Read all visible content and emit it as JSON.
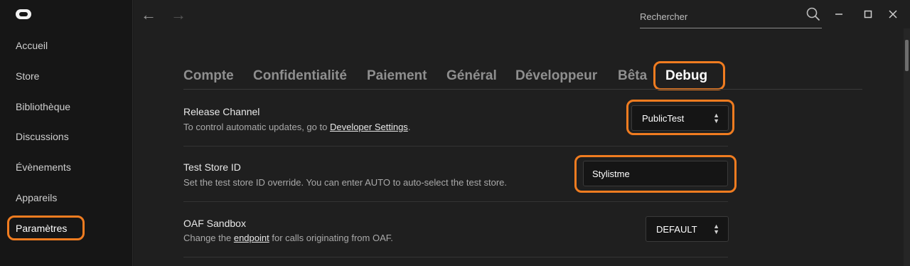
{
  "sidebar": {
    "logo": "oculus-logo",
    "items": [
      {
        "label": "Accueil"
      },
      {
        "label": "Store"
      },
      {
        "label": "Bibliothèque"
      },
      {
        "label": "Discussions"
      },
      {
        "label": "Évènements"
      },
      {
        "label": "Appareils"
      },
      {
        "label": "Paramètres",
        "active": true
      }
    ]
  },
  "header": {
    "search_placeholder": "Rechercher",
    "icons": [
      "arrow-left-icon",
      "arrow-right-icon",
      "search-icon",
      "minimize-icon",
      "maximize-icon",
      "close-icon"
    ]
  },
  "tabs": [
    {
      "label": "Compte"
    },
    {
      "label": "Confidentialité"
    },
    {
      "label": "Paiement"
    },
    {
      "label": "Général"
    },
    {
      "label": "Développeur"
    },
    {
      "label": "Bêta"
    },
    {
      "label": "Debug",
      "active": true
    }
  ],
  "settings": {
    "release_channel": {
      "title": "Release Channel",
      "desc_prefix": "To control automatic updates, go to ",
      "desc_link": "Developer Settings",
      "desc_suffix": ".",
      "value": "PublicTest"
    },
    "test_store": {
      "title": "Test Store ID",
      "desc": "Set the test store ID override. You can enter AUTO to auto-select the test store.",
      "value": "Stylistme"
    },
    "oaf_sandbox": {
      "title": "OAF Sandbox",
      "desc_prefix": "Change the ",
      "desc_link": "endpoint",
      "desc_suffix": " for calls originating from OAF.",
      "value": "DEFAULT"
    }
  },
  "colors": {
    "highlight": "#f07c20",
    "background": "#1f1f1f",
    "sidebar": "#161616"
  }
}
